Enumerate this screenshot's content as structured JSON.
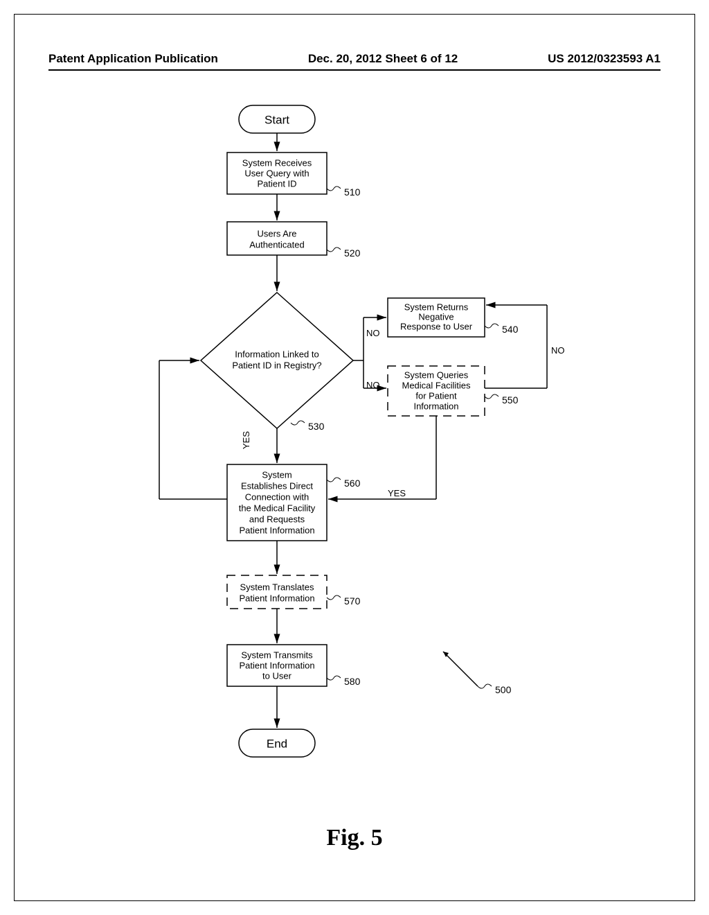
{
  "header": {
    "left": "Patent Application Publication",
    "center": "Dec. 20, 2012  Sheet 6 of 12",
    "right": "US 2012/0323593 A1"
  },
  "figure_label": "Fig. 5",
  "nodes": {
    "start": "Start",
    "end": "End",
    "step510": {
      "line1": "System Receives",
      "line2": "User Query with",
      "line3": "Patient ID",
      "ref": "510"
    },
    "step520": {
      "line1": "Users Are",
      "line2": "Authenticated",
      "ref": "520"
    },
    "decision530": {
      "line1": "Information Linked to",
      "line2": "Patient ID in Registry?",
      "ref": "530"
    },
    "step540": {
      "line1": "System Returns",
      "line2": "Negative",
      "line3": "Response to User",
      "ref": "540"
    },
    "step550": {
      "line1": "System Queries",
      "line2": "Medical Facilities",
      "line3": "for Patient",
      "line4": "Information",
      "ref": "550"
    },
    "step560": {
      "line1": "System",
      "line2": "Establishes Direct",
      "line3": "Connection with",
      "line4": "the Medical Facility",
      "line5": "and Requests",
      "line6": "Patient Information",
      "ref": "560"
    },
    "step570": {
      "line1": "System Translates",
      "line2": "Patient Information",
      "ref": "570"
    },
    "step580": {
      "line1": "System Transmits",
      "line2": "Patient Information",
      "line3": "to User",
      "ref": "580"
    },
    "figure_ref": "500"
  },
  "labels": {
    "yes": "YES",
    "no": "NO"
  }
}
